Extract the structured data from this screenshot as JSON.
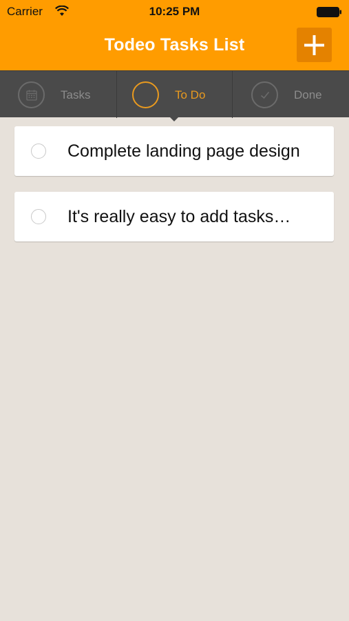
{
  "status_bar": {
    "carrier": "Carrier",
    "time": "10:25 PM"
  },
  "header": {
    "title": "Todeo Tasks List",
    "add_icon": "plus-icon",
    "background": "#ff9c00"
  },
  "tabs": [
    {
      "label": "Tasks",
      "icon": "calendar-icon",
      "active": false
    },
    {
      "label": "To Do",
      "icon": "circle-icon",
      "active": true
    },
    {
      "label": "Done",
      "icon": "checkmark-icon",
      "active": false
    }
  ],
  "tasks": [
    {
      "title": "Complete landing page design",
      "done": false
    },
    {
      "title": "It's really easy to add tasks…",
      "done": false
    }
  ],
  "colors": {
    "accent": "#ff9c00",
    "active_tab": "#e99a1f",
    "tabbar": "#4a4a4a",
    "background": "#e7e1da"
  }
}
